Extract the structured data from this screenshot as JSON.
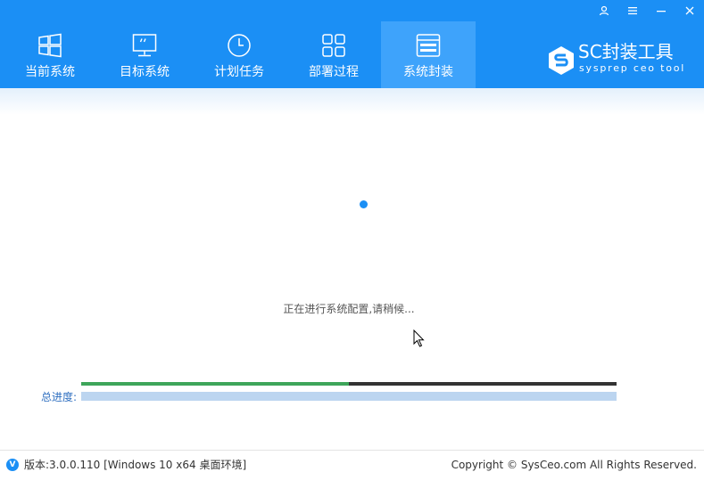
{
  "window_controls": [
    {
      "name": "user-icon",
      "glyph": "A"
    },
    {
      "name": "menu-icon",
      "glyph": "≡"
    },
    {
      "name": "minimize-icon",
      "glyph": "—"
    },
    {
      "name": "close-icon",
      "glyph": "✕"
    }
  ],
  "tabs": [
    {
      "label": "当前系统",
      "icon": "windows-icon",
      "active": false
    },
    {
      "label": "目标系统",
      "icon": "monitor-icon",
      "active": false
    },
    {
      "label": "计划任务",
      "icon": "clock-icon",
      "active": false
    },
    {
      "label": "部署过程",
      "icon": "grid-icon",
      "active": false
    },
    {
      "label": "系统封装",
      "icon": "package-icon",
      "active": true
    }
  ],
  "brand": {
    "title": "SC封装工具",
    "subtitle": "sysprep ceo tool"
  },
  "main": {
    "status_text": "正在进行系统配置,请稍候...",
    "step_progress": 0.5,
    "total_label": "总进度:",
    "total_progress": 0
  },
  "footer": {
    "version_badge": "V",
    "version_text": "版本:3.0.0.110 [Windows 10 x64 桌面环境]",
    "copyright": "Copyright © SysCeo.com All Rights Reserved."
  },
  "colors": {
    "header": "#1b8ff5",
    "active_tab": "#3ea3fb",
    "step_fill": "#3ea55a",
    "step_track": "#333333",
    "total_track": "#bcd5f0",
    "accent": "#1b8ff5"
  }
}
